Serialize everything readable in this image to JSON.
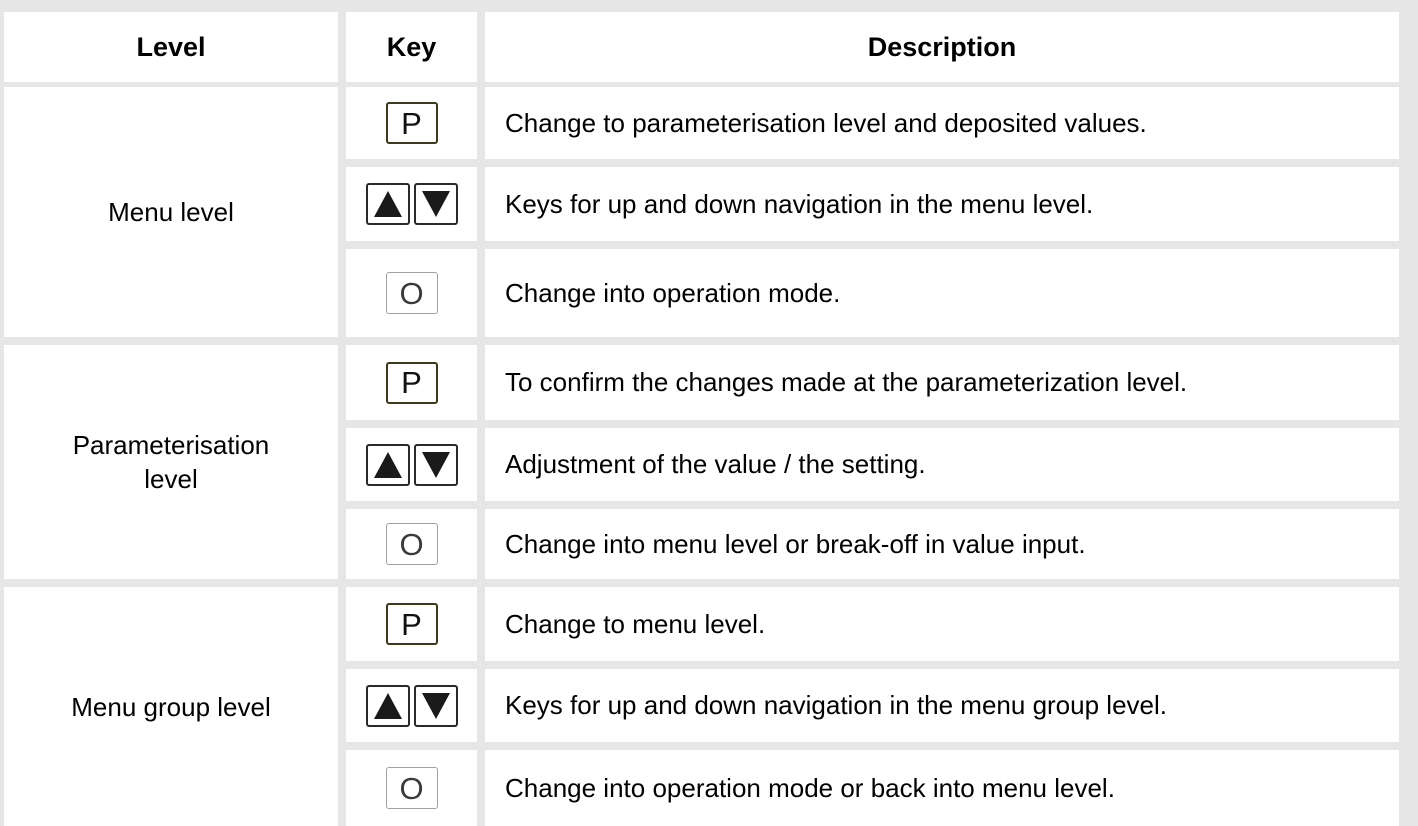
{
  "table": {
    "headers": {
      "level": "Level",
      "key": "Key",
      "description": "Description"
    },
    "groups": [
      {
        "level": "Menu level",
        "rows": [
          {
            "key": "P",
            "description": "Change to parameterisation level and deposited values."
          },
          {
            "key": "up-down-arrows",
            "description": "Keys for up and down navigation in the menu level."
          },
          {
            "key": "O",
            "description": "Change into operation mode."
          }
        ]
      },
      {
        "level": "Parameterisation\nlevel",
        "rows": [
          {
            "key": "P",
            "description": "To confirm the changes made at the parameterization level."
          },
          {
            "key": "up-down-arrows",
            "description": "Adjustment of the value / the setting."
          },
          {
            "key": "O",
            "description": "Change into menu level or break-off in value input."
          }
        ]
      },
      {
        "level": "Menu group level",
        "rows": [
          {
            "key": "P",
            "description": "Change to menu level."
          },
          {
            "key": "up-down-arrows",
            "description": "Keys for up and down navigation in the menu group level."
          },
          {
            "key": "O",
            "description": "Change into operation mode or back into menu level."
          }
        ]
      }
    ]
  },
  "icons": {
    "up": "arrow-up-icon",
    "down": "arrow-down-icon"
  },
  "colors": {
    "grid": "#e6e6e6",
    "cell": "#ffffff",
    "text": "#000000",
    "key_border_p": "#3d3a1c",
    "key_border_o": "#a0a0a0"
  }
}
